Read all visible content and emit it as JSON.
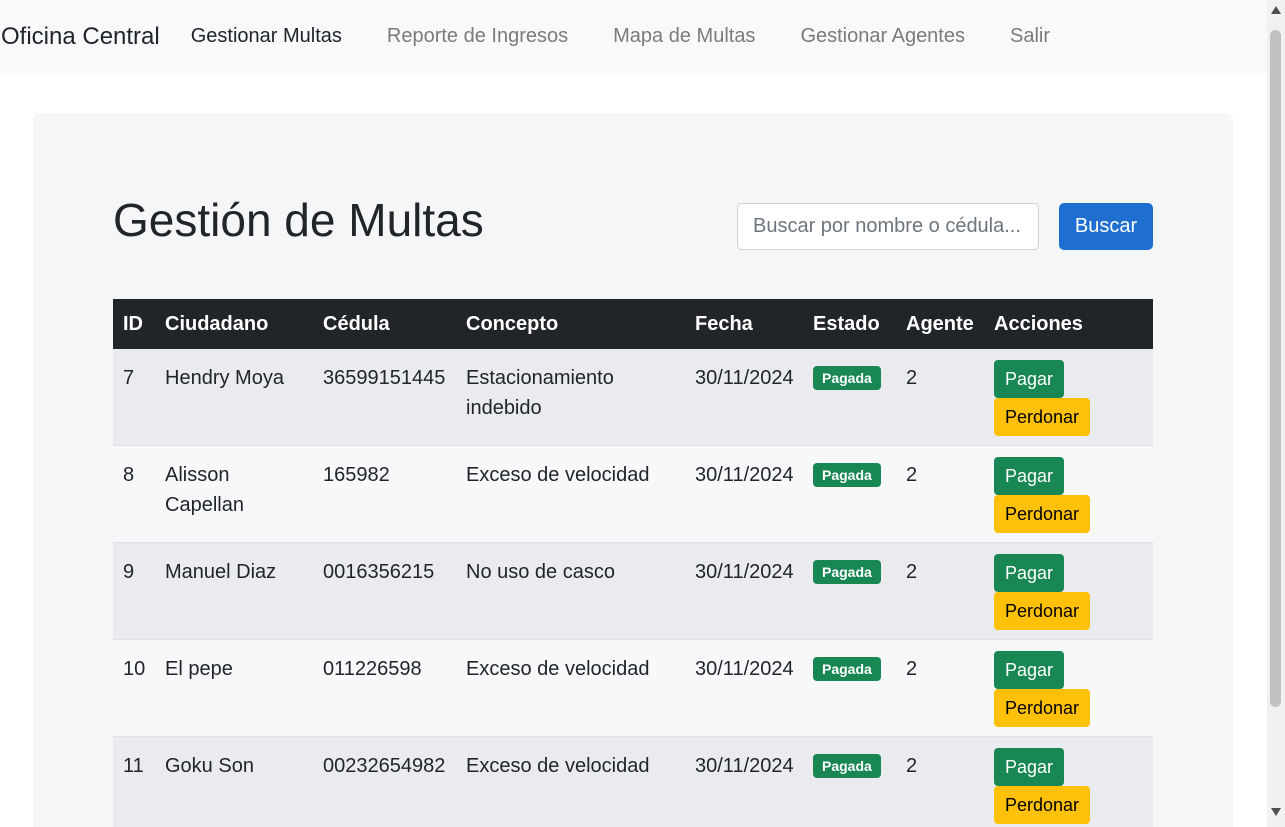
{
  "navbar": {
    "brand": "Oficina Central",
    "links": [
      "Gestionar Multas",
      "Reporte de Ingresos",
      "Mapa de Multas",
      "Gestionar Agentes",
      "Salir"
    ]
  },
  "page": {
    "title": "Gestión de Multas",
    "search_placeholder": "Buscar por nombre o cédula...",
    "search_button": "Buscar"
  },
  "table": {
    "headers": [
      "ID",
      "Ciudadano",
      "Cédula",
      "Concepto",
      "Fecha",
      "Estado",
      "Agente",
      "Acciones"
    ],
    "rows": [
      {
        "id": "7",
        "ciudadano": "Hendry Moya",
        "cedula": "36599151445",
        "concepto": "Estacionamiento indebido",
        "fecha": "30/11/2024",
        "estado": "Pagada",
        "agente": "2"
      },
      {
        "id": "8",
        "ciudadano": "Alisson Capellan",
        "cedula": "165982",
        "concepto": "Exceso de velocidad",
        "fecha": "30/11/2024",
        "estado": "Pagada",
        "agente": "2"
      },
      {
        "id": "9",
        "ciudadano": "Manuel Diaz",
        "cedula": "0016356215",
        "concepto": "No uso de casco",
        "fecha": "30/11/2024",
        "estado": "Pagada",
        "agente": "2"
      },
      {
        "id": "10",
        "ciudadano": "El pepe",
        "cedula": "011226598",
        "concepto": "Exceso de velocidad",
        "fecha": "30/11/2024",
        "estado": "Pagada",
        "agente": "2"
      },
      {
        "id": "11",
        "ciudadano": "Goku Son",
        "cedula": "00232654982",
        "concepto": "Exceso de velocidad",
        "fecha": "30/11/2024",
        "estado": "Pagada",
        "agente": "2"
      }
    ],
    "pay_label": "Pagar",
    "forgive_label": "Perdonar"
  },
  "colors": {
    "header_bg": "#212529",
    "badge_paid": "#198754",
    "pay_button": "#198754",
    "forgive_button": "#ffc107",
    "search_button": "#1f6fd1"
  }
}
